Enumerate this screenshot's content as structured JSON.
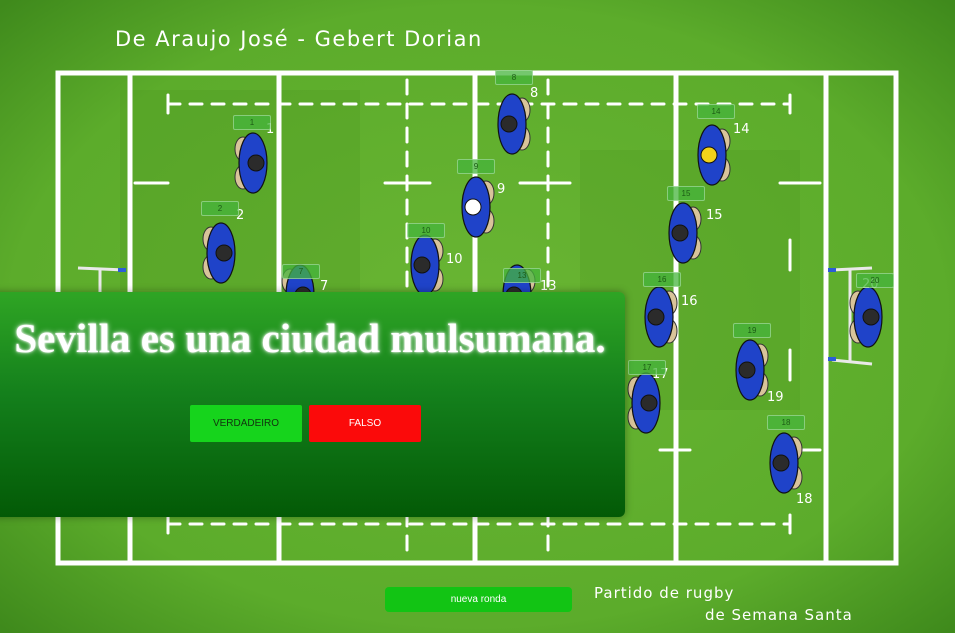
{
  "header": {
    "authors": "De Araujo José - Gebert Dorian"
  },
  "footer": {
    "title_line1": "Partido de rugby",
    "title_line2": "de Semana Santa"
  },
  "question": {
    "text": "Sevilla es una ciudad mulsumana."
  },
  "buttons": {
    "true_label": "VERDADEIRO",
    "false_label": "FALSO",
    "new_round_label": "nueva ronda"
  },
  "players": [
    {
      "number": "1",
      "tag": "1",
      "team": "blue"
    },
    {
      "number": "2",
      "tag": "2",
      "team": "blue"
    },
    {
      "number": "7",
      "tag": "7",
      "team": "blue"
    },
    {
      "number": "8",
      "tag": "8",
      "team": "blue"
    },
    {
      "number": "9",
      "tag": "9",
      "team": "blue"
    },
    {
      "number": "10",
      "tag": "10",
      "team": "blue"
    },
    {
      "number": "13",
      "tag": "13",
      "team": "blue"
    },
    {
      "number": "14",
      "tag": "14",
      "team": "blue"
    },
    {
      "number": "15",
      "tag": "15",
      "team": "blue"
    },
    {
      "number": "16",
      "tag": "16",
      "team": "blue"
    },
    {
      "number": "17",
      "tag": "17",
      "team": "blue"
    },
    {
      "number": "18",
      "tag": "18",
      "team": "blue"
    },
    {
      "number": "19",
      "tag": "19",
      "team": "blue"
    },
    {
      "number": "20",
      "tag": "20",
      "team": "blue"
    }
  ],
  "colors": {
    "field": "#5fae2c",
    "jersey": "#1f43c9",
    "panel_top": "#2fa524",
    "panel_bottom": "#035a06",
    "true_button": "#16d41c",
    "false_button": "#fb0a0a",
    "new_round_button": "#12c414"
  }
}
